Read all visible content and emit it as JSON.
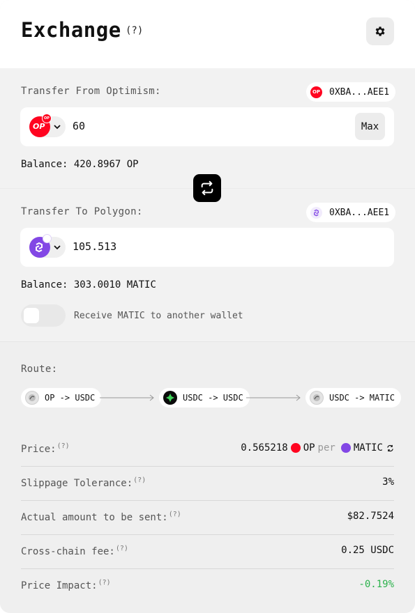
{
  "header": {
    "title": "Exchange",
    "help": "(?)"
  },
  "from": {
    "label": "Transfer From Optimism:",
    "address": "0XBA...AEE1",
    "amount": "60",
    "max_label": "Max",
    "balance_label": "Balance:",
    "balance_value": "420.8967 OP",
    "token_icon": "optimism-token-icon",
    "chain_badge": "OP"
  },
  "to": {
    "label": "Transfer To Polygon:",
    "address": "0XBA...AEE1",
    "amount": "105.513",
    "balance_label": "Balance:",
    "balance_value": "303.0010 MATIC",
    "token_icon": "polygon-token-icon",
    "toggle_label": "Receive MATIC to another wallet",
    "toggle_on": false
  },
  "route": {
    "label": "Route:",
    "steps": [
      {
        "label": "OP -> USDC"
      },
      {
        "label": "USDC -> USDC"
      },
      {
        "label": "USDC -> MATIC"
      }
    ]
  },
  "details": {
    "price": {
      "label": "Price:",
      "help": "(?)",
      "value": "0.565218",
      "token_a": "OP",
      "per": "per",
      "token_b": "MATIC"
    },
    "slippage": {
      "label": "Slippage Tolerance:",
      "help": "(?)",
      "value": "3%"
    },
    "actual": {
      "label": "Actual amount to be sent:",
      "help": "(?)",
      "value": "$82.7524"
    },
    "fee": {
      "label": "Cross-chain fee:",
      "help": "(?)",
      "value": "0.25 USDC"
    },
    "impact": {
      "label": "Price Impact:",
      "help": "(?)",
      "value": "-0.19%"
    }
  },
  "colors": {
    "op_red": "#ff0420",
    "polygon_purple": "#8247e5",
    "impact_green": "#2bb24c"
  }
}
